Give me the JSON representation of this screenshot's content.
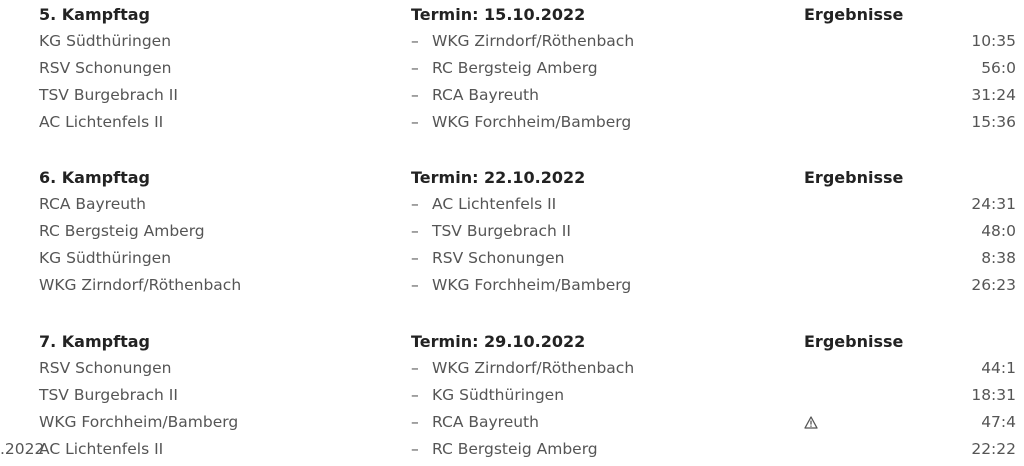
{
  "matchdays": [
    {
      "day": "5. Kampftag",
      "date": "Termin: 15.10.2022",
      "results_label": "Ergebnisse",
      "matches": [
        {
          "home": "KG Südthüringen",
          "dash": "–",
          "away": "WKG Zirndorf/Röthenbach",
          "score": "10:35"
        },
        {
          "home": "RSV Schonungen",
          "dash": "–",
          "away": "RC Bergsteig Amberg",
          "score": "56:0"
        },
        {
          "home": "TSV Burgebrach II",
          "dash": "–",
          "away": "RCA Bayreuth",
          "score": "31:24"
        },
        {
          "home": "AC Lichtenfels II",
          "dash": "–",
          "away": "WKG Forchheim/Bamberg",
          "score": "15:36"
        }
      ]
    },
    {
      "day": "6. Kampftag",
      "date": "Termin: 22.10.2022",
      "results_label": "Ergebnisse",
      "matches": [
        {
          "home": "RCA Bayreuth",
          "dash": "–",
          "away": "AC Lichtenfels II",
          "score": "24:31"
        },
        {
          "home": "RC Bergsteig Amberg",
          "dash": "–",
          "away": "TSV Burgebrach II",
          "score": "48:0"
        },
        {
          "home": "KG Südthüringen",
          "dash": "–",
          "away": "RSV Schonungen",
          "score": "8:38"
        },
        {
          "home": "WKG Zirndorf/Röthenbach",
          "dash": "–",
          "away": "WKG Forchheim/Bamberg",
          "score": "26:23"
        }
      ]
    },
    {
      "day": "7. Kampftag",
      "date": "Termin: 29.10.2022",
      "results_label": "Ergebnisse",
      "matches": [
        {
          "home": "RSV Schonungen",
          "dash": "–",
          "away": "WKG Zirndorf/Röthenbach",
          "score": "44:1"
        },
        {
          "home": "TSV Burgebrach II",
          "dash": "–",
          "away": "KG Südthüringen",
          "score": "18:31"
        },
        {
          "home": "WKG Forchheim/Bamberg",
          "dash": "–",
          "away": "RCA Bayreuth",
          "score": "47:4",
          "icon": "warning-icon"
        },
        {
          "home": "AC Lichtenfels II",
          "dash": "–",
          "away": "RC Bergsteig Amberg",
          "score": "22:22",
          "edge_text": ".2022"
        }
      ]
    }
  ]
}
